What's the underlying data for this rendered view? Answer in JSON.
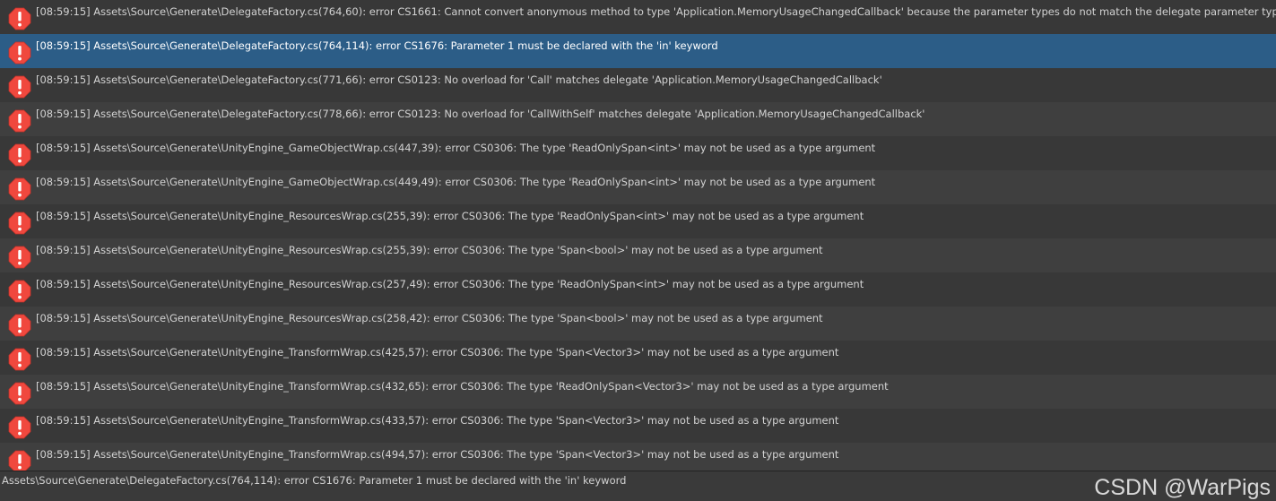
{
  "console": {
    "entries": [
      {
        "text": "[08:59:15] Assets\\Source\\Generate\\DelegateFactory.cs(764,60): error CS1661: Cannot convert anonymous method to type 'Application.MemoryUsageChangedCallback' because the parameter types do not match the delegate parameter types",
        "icon": "error-icon",
        "selected": false
      },
      {
        "text": "[08:59:15] Assets\\Source\\Generate\\DelegateFactory.cs(764,114): error CS1676: Parameter 1 must be declared with the 'in' keyword",
        "icon": "error-icon",
        "selected": true
      },
      {
        "text": "[08:59:15] Assets\\Source\\Generate\\DelegateFactory.cs(771,66): error CS0123: No overload for 'Call' matches delegate 'Application.MemoryUsageChangedCallback'",
        "icon": "error-icon",
        "selected": false
      },
      {
        "text": "[08:59:15] Assets\\Source\\Generate\\DelegateFactory.cs(778,66): error CS0123: No overload for 'CallWithSelf' matches delegate 'Application.MemoryUsageChangedCallback'",
        "icon": "error-icon",
        "selected": false
      },
      {
        "text": "[08:59:15] Assets\\Source\\Generate\\UnityEngine_GameObjectWrap.cs(447,39): error CS0306: The type 'ReadOnlySpan<int>' may not be used as a type argument",
        "icon": "error-icon",
        "selected": false
      },
      {
        "text": "[08:59:15] Assets\\Source\\Generate\\UnityEngine_GameObjectWrap.cs(449,49): error CS0306: The type 'ReadOnlySpan<int>' may not be used as a type argument",
        "icon": "error-icon",
        "selected": false
      },
      {
        "text": "[08:59:15] Assets\\Source\\Generate\\UnityEngine_ResourcesWrap.cs(255,39): error CS0306: The type 'ReadOnlySpan<int>' may not be used as a type argument",
        "icon": "error-icon",
        "selected": false
      },
      {
        "text": "[08:59:15] Assets\\Source\\Generate\\UnityEngine_ResourcesWrap.cs(255,39): error CS0306: The type 'Span<bool>' may not be used as a type argument",
        "icon": "error-icon",
        "selected": false
      },
      {
        "text": "[08:59:15] Assets\\Source\\Generate\\UnityEngine_ResourcesWrap.cs(257,49): error CS0306: The type 'ReadOnlySpan<int>' may not be used as a type argument",
        "icon": "error-icon",
        "selected": false
      },
      {
        "text": "[08:59:15] Assets\\Source\\Generate\\UnityEngine_ResourcesWrap.cs(258,42): error CS0306: The type 'Span<bool>' may not be used as a type argument",
        "icon": "error-icon",
        "selected": false
      },
      {
        "text": "[08:59:15] Assets\\Source\\Generate\\UnityEngine_TransformWrap.cs(425,57): error CS0306: The type 'Span<Vector3>' may not be used as a type argument",
        "icon": "error-icon",
        "selected": false
      },
      {
        "text": "[08:59:15] Assets\\Source\\Generate\\UnityEngine_TransformWrap.cs(432,65): error CS0306: The type 'ReadOnlySpan<Vector3>' may not be used as a type argument",
        "icon": "error-icon",
        "selected": false
      },
      {
        "text": "[08:59:15] Assets\\Source\\Generate\\UnityEngine_TransformWrap.cs(433,57): error CS0306: The type 'Span<Vector3>' may not be used as a type argument",
        "icon": "error-icon",
        "selected": false
      },
      {
        "text": "[08:59:15] Assets\\Source\\Generate\\UnityEngine_TransformWrap.cs(494,57): error CS0306: The type 'Span<Vector3>' may not be used as a type argument",
        "icon": "error-icon",
        "selected": false
      }
    ]
  },
  "status_bar": {
    "text": "Assets\\Source\\Generate\\DelegateFactory.cs(764,114): error CS1676: Parameter 1 must be declared with the 'in' keyword"
  },
  "watermark": {
    "text": "CSDN @WarPigs"
  },
  "colors": {
    "background": "#383838",
    "row_alt": "#3f3f3f",
    "selected": "#2c5d87",
    "error_icon": "#f0483e",
    "text": "#d2d2d2"
  }
}
